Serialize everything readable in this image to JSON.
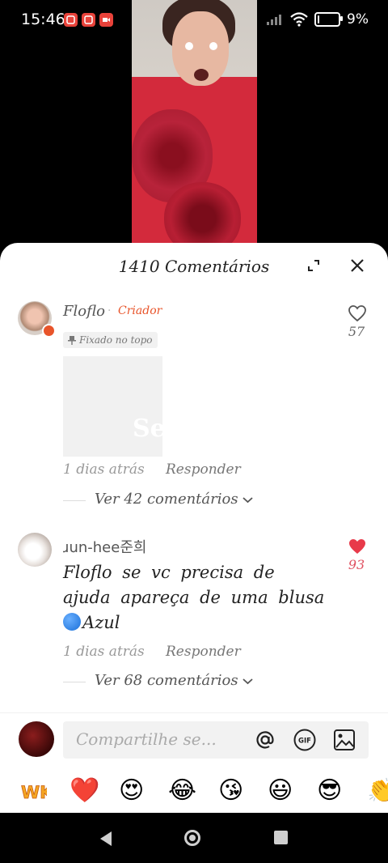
{
  "status_bar": {
    "time": "15:46",
    "battery_percent": "9%",
    "battery_level": 0.09
  },
  "sheet": {
    "title": "1410  Comentários"
  },
  "comments": [
    {
      "author": "Floflo",
      "creator_label": "Criador",
      "pinned_label": "Fixado  no  topo",
      "thumb_text": "Se",
      "time": "1  dias  atrás",
      "reply": "Responder",
      "replies_text": "Ver  42  comentários",
      "likes": "57",
      "liked": false
    },
    {
      "author": "ɹun-hee준희",
      "text": "Floflo  se  vc  precisa  de  ajuda  apareça  de  uma    blusa",
      "text2": "Azul",
      "time": "1  dias  atrás",
      "reply": "Responder",
      "replies_text": "Ver  68  comentários",
      "likes": "93",
      "liked": true
    }
  ],
  "input": {
    "placeholder": "Compartilhe  se..."
  },
  "emojis": [
    "wk-sticker",
    "❤️",
    "😍",
    "😂",
    "😘",
    "😃",
    "😎",
    "👏"
  ],
  "colors": {
    "accent": "#e8542a",
    "like_red": "#e83a4a"
  }
}
